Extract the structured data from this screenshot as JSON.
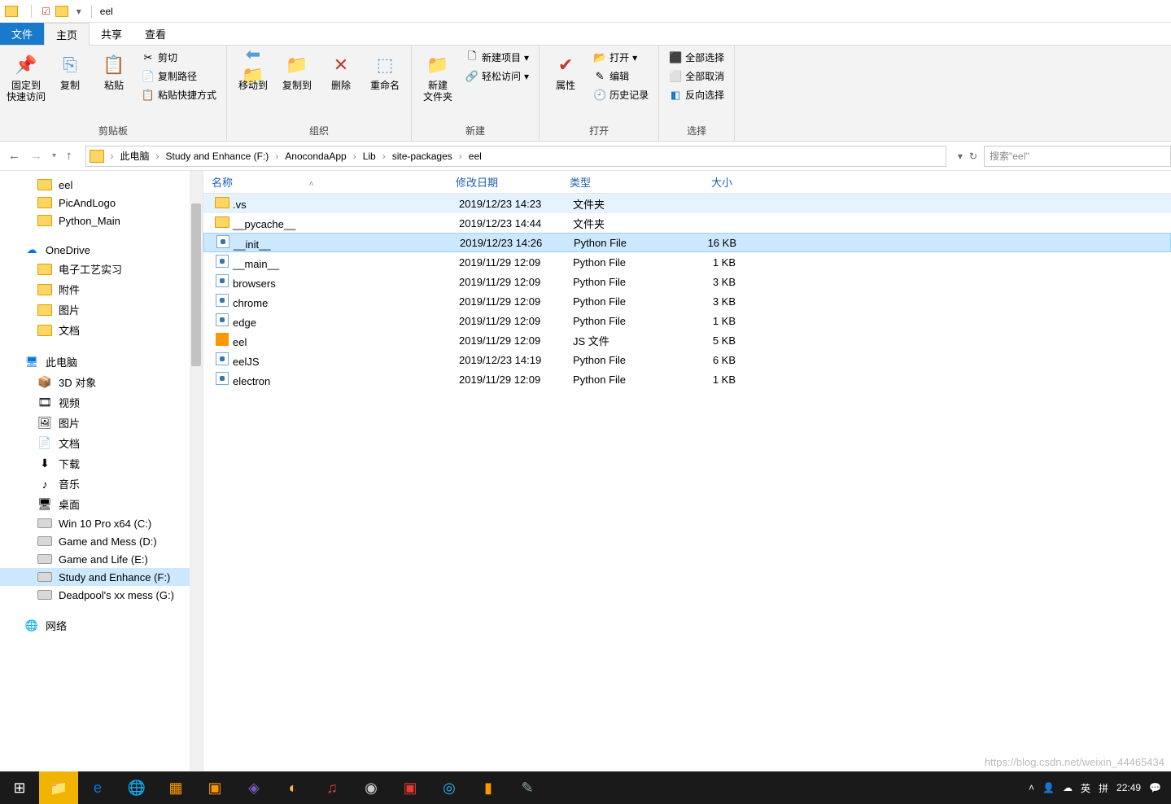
{
  "window": {
    "title": "eel"
  },
  "tabs": {
    "file": "文件",
    "home": "主页",
    "share": "共享",
    "view": "查看"
  },
  "ribbon": {
    "clipboard": {
      "group": "剪贴板",
      "pin": "固定到\n快速访问",
      "copy": "复制",
      "paste": "粘贴",
      "cut": "剪切",
      "copypath": "复制路径",
      "pasteshortcut": "粘贴快捷方式"
    },
    "organize": {
      "group": "组织",
      "moveto": "移动到",
      "copyto": "复制到",
      "delete": "删除",
      "rename": "重命名"
    },
    "new": {
      "group": "新建",
      "newfolder": "新建\n文件夹",
      "newitem": "新建项目",
      "easyaccess": "轻松访问"
    },
    "open": {
      "group": "打开",
      "properties": "属性",
      "open": "打开",
      "edit": "编辑",
      "history": "历史记录"
    },
    "select": {
      "group": "选择",
      "selectall": "全部选择",
      "selectnone": "全部取消",
      "invert": "反向选择"
    }
  },
  "breadcrumb": {
    "items": [
      "此电脑",
      "Study and Enhance (F:)",
      "AnocondaApp",
      "Lib",
      "site-packages",
      "eel"
    ]
  },
  "search": {
    "placeholder": "搜索\"eel\""
  },
  "sidebar": {
    "quick": [
      {
        "label": "eel",
        "icon": "folder"
      },
      {
        "label": "PicAndLogo",
        "icon": "folder"
      },
      {
        "label": "Python_Main",
        "icon": "folder"
      }
    ],
    "onedrive": {
      "label": "OneDrive"
    },
    "onedrive_items": [
      {
        "label": "电子工艺实习",
        "icon": "folder"
      },
      {
        "label": "附件",
        "icon": "folder"
      },
      {
        "label": "图片",
        "icon": "folder"
      },
      {
        "label": "文档",
        "icon": "folder"
      }
    ],
    "thispc": {
      "label": "此电脑"
    },
    "thispc_items": [
      {
        "label": "3D 对象",
        "icon": "cube"
      },
      {
        "label": "视频",
        "icon": "video"
      },
      {
        "label": "图片",
        "icon": "image"
      },
      {
        "label": "文档",
        "icon": "doc"
      },
      {
        "label": "下载",
        "icon": "download"
      },
      {
        "label": "音乐",
        "icon": "music"
      },
      {
        "label": "桌面",
        "icon": "desktop"
      },
      {
        "label": "Win 10 Pro x64 (C:)",
        "icon": "drive"
      },
      {
        "label": "Game and Mess (D:)",
        "icon": "drive"
      },
      {
        "label": "Game and Life (E:)",
        "icon": "drive"
      },
      {
        "label": "Study and Enhance (F:)",
        "icon": "drive",
        "selected": true
      },
      {
        "label": "Deadpool's xx mess (G:)",
        "icon": "drive"
      }
    ],
    "network": {
      "label": "网络"
    }
  },
  "columns": {
    "name": "名称",
    "date": "修改日期",
    "type": "类型",
    "size": "大小"
  },
  "files": [
    {
      "name": ".vs",
      "date": "2019/12/23 14:23",
      "type": "文件夹",
      "size": "",
      "icon": "folder",
      "highlight": true
    },
    {
      "name": "__pycache__",
      "date": "2019/12/23 14:44",
      "type": "文件夹",
      "size": "",
      "icon": "folder"
    },
    {
      "name": "__init__",
      "date": "2019/12/23 14:26",
      "type": "Python File",
      "size": "16 KB",
      "icon": "py",
      "selected": true
    },
    {
      "name": "__main__",
      "date": "2019/11/29 12:09",
      "type": "Python File",
      "size": "1 KB",
      "icon": "py"
    },
    {
      "name": "browsers",
      "date": "2019/11/29 12:09",
      "type": "Python File",
      "size": "3 KB",
      "icon": "py"
    },
    {
      "name": "chrome",
      "date": "2019/11/29 12:09",
      "type": "Python File",
      "size": "3 KB",
      "icon": "py"
    },
    {
      "name": "edge",
      "date": "2019/11/29 12:09",
      "type": "Python File",
      "size": "1 KB",
      "icon": "py"
    },
    {
      "name": "eel",
      "date": "2019/11/29 12:09",
      "type": "JS 文件",
      "size": "5 KB",
      "icon": "js"
    },
    {
      "name": "eelJS",
      "date": "2019/12/23 14:19",
      "type": "Python File",
      "size": "6 KB",
      "icon": "py"
    },
    {
      "name": "electron",
      "date": "2019/11/29 12:09",
      "type": "Python File",
      "size": "1 KB",
      "icon": "py"
    }
  ],
  "tray": {
    "clock": "22:49",
    "watermark": "https://blog.csdn.net/weixin_44465434"
  }
}
